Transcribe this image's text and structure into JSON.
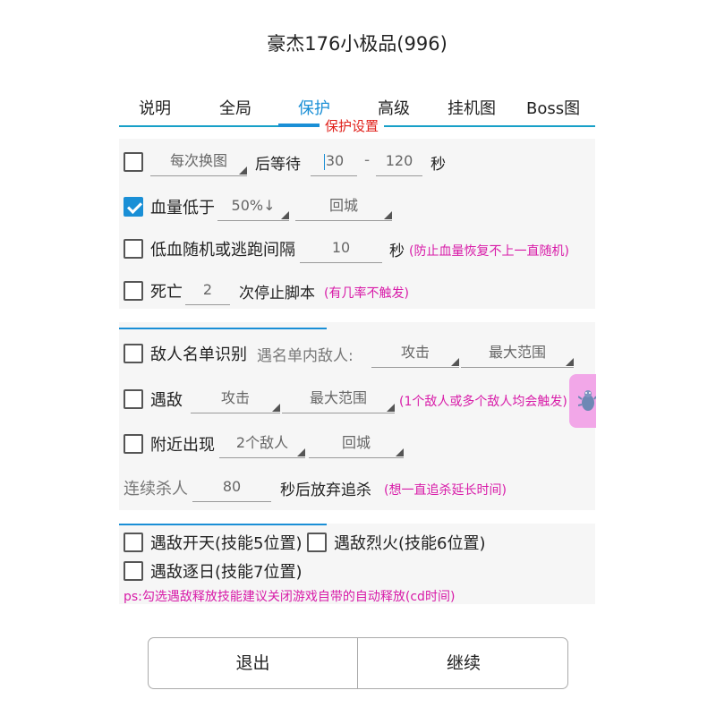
{
  "title": "豪杰176小极品(996)",
  "tabs": [
    "说明",
    "全局",
    "保护",
    "高级",
    "挂机图",
    "Boss图"
  ],
  "active_tab": "保护",
  "section_title": "保护设置",
  "rows": {
    "map_change": {
      "checked": false,
      "select": "每次换图",
      "label": "后等待",
      "from": "30",
      "dash": "-",
      "to": "120",
      "unit": "秒"
    },
    "hp_low": {
      "checked": true,
      "label": "血量低于",
      "threshold": "50%↓",
      "action": "回城"
    },
    "low_hp_random": {
      "checked": false,
      "label": "低血随机或逃跑间隔",
      "value": "10",
      "unit": "秒",
      "hint": "(防止血量恢复不上一直随机)"
    },
    "death": {
      "checked": false,
      "label": "死亡",
      "value": "2",
      "suffix": "次停止脚本",
      "hint": "(有几率不触发)"
    },
    "enemy_list": {
      "checked": false,
      "label": "敌人名单识别",
      "sub_label": "遇名单内敌人:",
      "action": "攻击",
      "range": "最大范围"
    },
    "meet_enemy": {
      "checked": false,
      "label": "遇敌",
      "action": "攻击",
      "range": "最大范围",
      "hint": "(1个敌人或多个敌人均会触发)"
    },
    "nearby": {
      "checked": false,
      "label": "附近出现",
      "count": "2个敌人",
      "action": "回城"
    },
    "chase": {
      "label": "连续杀人",
      "value": "80",
      "suffix": "秒后放弃追杀",
      "hint": "(想一直追杀延长时间)"
    }
  },
  "skills": {
    "skill5": {
      "checked": false,
      "label": "遇敌开天(技能5位置)"
    },
    "skill6": {
      "checked": false,
      "label": "遇敌烈火(技能6位置)"
    },
    "skill7": {
      "checked": false,
      "label": "遇敌逐日(技能7位置)"
    },
    "note": "ps:勾选遇敌释放技能建议关闭游戏自带的自动释放(cd时间)"
  },
  "buttons": {
    "exit": "退出",
    "continue": "继续"
  },
  "colors": {
    "accent": "#1a8fd6",
    "section_title": "#e0201a",
    "hint": "#d81ba8",
    "float_button": "#f2a7e8"
  },
  "icons": {
    "float_button": "bug-icon"
  }
}
